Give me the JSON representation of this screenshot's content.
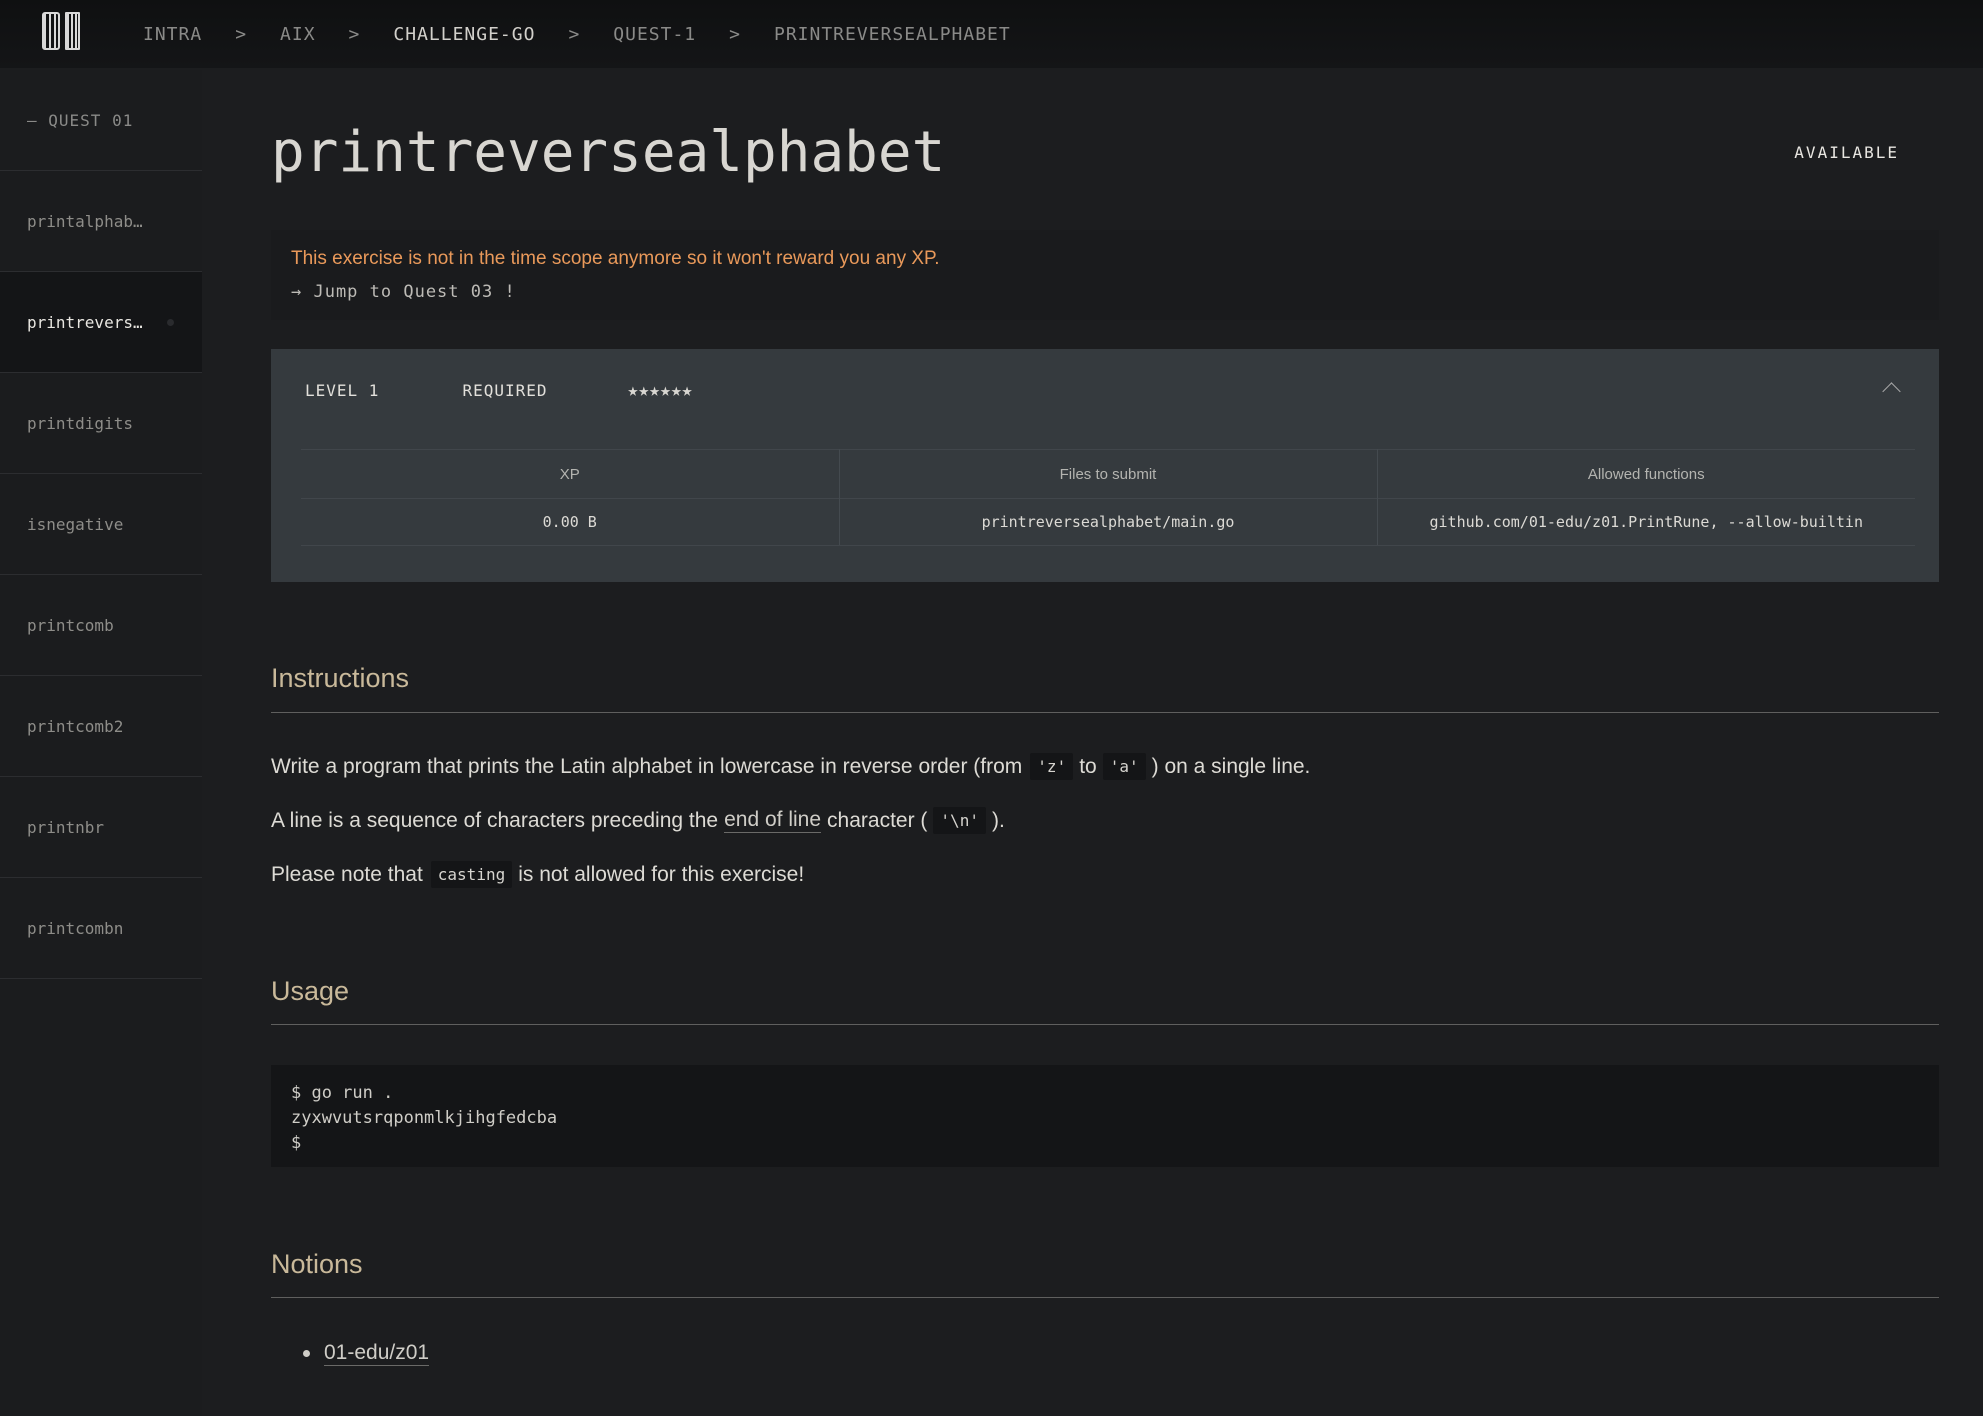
{
  "topbar": {
    "logo_text": "01",
    "breadcrumbs": [
      "INTRA",
      "AIX",
      "CHALLENGE-GO",
      "QUEST-1",
      "PRINTREVERSEALPHABET"
    ],
    "separator": ">"
  },
  "sidebar": {
    "heading": "— QUEST 01",
    "items": [
      {
        "label": "printalphab…"
      },
      {
        "label": "printrevers…"
      },
      {
        "label": "printdigits"
      },
      {
        "label": "isnegative"
      },
      {
        "label": "printcomb"
      },
      {
        "label": "printcomb2"
      },
      {
        "label": "printnbr"
      },
      {
        "label": "printcombn"
      }
    ]
  },
  "exercise": {
    "title": "printreversealphabet",
    "status": "AVAILABLE",
    "warning": "This exercise is not in the time scope anymore so it won't reward you any XP.",
    "jump_link": "→ Jump to Quest 03 !"
  },
  "panel": {
    "level": "LEVEL 1",
    "required": "REQUIRED",
    "stars": "★★★★★★",
    "headers": [
      "XP",
      "Files to submit",
      "Allowed functions"
    ],
    "values": [
      "0.00 B",
      "printreversealphabet/main.go",
      "github.com/01-edu/z01.PrintRune, --allow-builtin"
    ]
  },
  "instructions": {
    "heading": "Instructions",
    "p1_a": "Write a program that prints the Latin alphabet in lowercase in reverse order (from",
    "p1_code1": "'z'",
    "p1_b": "to",
    "p1_code2": "'a'",
    "p1_c": ") on a single line.",
    "p2_a": "A line is a sequence of characters preceding the",
    "p2_link": "end of line",
    "p2_b": "character (",
    "p2_code": "'\\n'",
    "p2_c": ").",
    "p3_a": "Please note that",
    "p3_code": "casting",
    "p3_b": "is not allowed for this exercise!"
  },
  "usage": {
    "heading": "Usage",
    "code": "$ go run .\nzyxwvutsrqponmlkjihgfedcba\n$"
  },
  "notions": {
    "heading": "Notions",
    "items": [
      "01-edu/z01"
    ]
  },
  "colors": {
    "background": "#1c1d1f",
    "warning": "#e9995a",
    "panel": "#353a3e",
    "section_heading": "#c9b99a"
  }
}
